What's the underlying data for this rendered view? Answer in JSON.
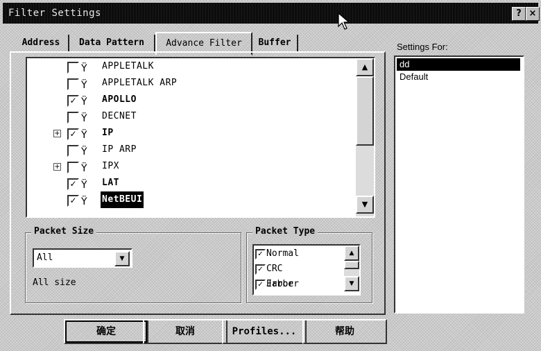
{
  "window": {
    "title": "Filter Settings"
  },
  "titlebar_buttons": {
    "help": "?",
    "close": "×"
  },
  "tabs": [
    {
      "label": "Address",
      "active": false
    },
    {
      "label": "Data Pattern",
      "active": false
    },
    {
      "label": "Advance Filter",
      "active": true
    },
    {
      "label": "Buffer",
      "active": false
    }
  ],
  "protocol_tree": {
    "items": [
      {
        "label": "APPLETALK",
        "checked": false,
        "bold": false,
        "expandable": false,
        "selected": false
      },
      {
        "label": "APPLETALK ARP",
        "checked": false,
        "bold": false,
        "expandable": false,
        "selected": false
      },
      {
        "label": "APOLLO",
        "checked": true,
        "bold": true,
        "expandable": false,
        "selected": false
      },
      {
        "label": "DECNET",
        "checked": false,
        "bold": false,
        "expandable": false,
        "selected": false
      },
      {
        "label": "IP",
        "checked": true,
        "bold": true,
        "expandable": true,
        "selected": false
      },
      {
        "label": "IP ARP",
        "checked": false,
        "bold": false,
        "expandable": false,
        "selected": false
      },
      {
        "label": "IPX",
        "checked": false,
        "bold": false,
        "expandable": true,
        "selected": false
      },
      {
        "label": "LAT",
        "checked": true,
        "bold": true,
        "expandable": false,
        "selected": false
      },
      {
        "label": "NetBEUI",
        "checked": true,
        "bold": true,
        "expandable": false,
        "selected": true
      }
    ],
    "icon": "network-protocol-icon"
  },
  "packet_size": {
    "title": "Packet Size",
    "selected": "All",
    "description": "All size"
  },
  "packet_type": {
    "title": "Packet Type",
    "items": [
      {
        "label": "Normal",
        "checked": true
      },
      {
        "label": "CRC Error",
        "checked": true
      },
      {
        "label": "Jabber",
        "checked": true
      }
    ]
  },
  "settings_for": {
    "label": "Settings For:",
    "items": [
      {
        "label": "dd",
        "selected": true
      },
      {
        "label": "Default",
        "selected": false
      }
    ]
  },
  "buttons": {
    "ok": "确定",
    "cancel": "取消",
    "profiles": "Profiles...",
    "help": "帮助"
  }
}
